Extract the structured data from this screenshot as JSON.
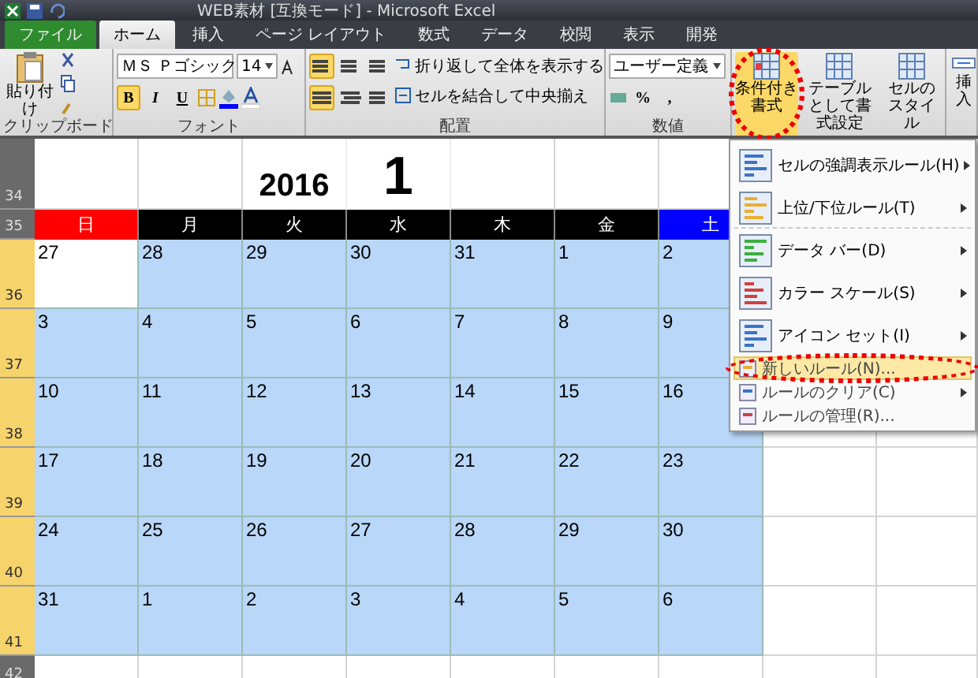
{
  "window": {
    "title": "WEB素材 [互換モード] - Microsoft Excel"
  },
  "tabs": [
    {
      "label": "ファイル",
      "kind": "file",
      "selected": false
    },
    {
      "label": "ホーム",
      "kind": "tab",
      "selected": true
    },
    {
      "label": "挿入",
      "kind": "tab",
      "selected": false
    },
    {
      "label": "ページ レイアウト",
      "kind": "tab",
      "selected": false
    },
    {
      "label": "数式",
      "kind": "tab",
      "selected": false
    },
    {
      "label": "データ",
      "kind": "tab",
      "selected": false
    },
    {
      "label": "校閲",
      "kind": "tab",
      "selected": false
    },
    {
      "label": "表示",
      "kind": "tab",
      "selected": false
    },
    {
      "label": "開発",
      "kind": "tab",
      "selected": false
    }
  ],
  "ribbon": {
    "clipboard": {
      "paste": "貼り付け",
      "label": "クリップボード"
    },
    "font": {
      "name": "ＭＳ Ｐゴシック",
      "size": "14",
      "label": "フォント",
      "styles": [
        {
          "text": "B",
          "selected": true
        },
        {
          "text": "I",
          "selected": false
        },
        {
          "text": "U",
          "selected": false
        }
      ]
    },
    "alignment": {
      "vertical": [
        {
          "selected": true
        },
        {
          "selected": false
        },
        {
          "selected": false
        }
      ],
      "horizontal": [
        {
          "selected": true
        },
        {
          "selected": false
        },
        {
          "selected": false
        }
      ],
      "wrap": "折り返して全体を表示する",
      "merge": "セルを結合して中央揃え",
      "label": "配置"
    },
    "number": {
      "format": "ユーザー定義",
      "percent": "%",
      "comma": ",",
      "label": "数値"
    },
    "styles": [
      {
        "label": "条件付き書式",
        "selected": true,
        "annotated": true
      },
      {
        "label": "テーブルとして書式設定",
        "selected": false,
        "annotated": false
      },
      {
        "label": "セルのスタイル",
        "selected": false,
        "annotated": false
      }
    ],
    "cells": {
      "insert": "挿入"
    }
  },
  "sheet": {
    "row_numbers": [
      {
        "label": "34",
        "selected": false
      },
      {
        "label": "35",
        "selected": false
      },
      {
        "label": "36",
        "selected": true
      },
      {
        "label": "37",
        "selected": true
      },
      {
        "label": "38",
        "selected": true
      },
      {
        "label": "39",
        "selected": true
      },
      {
        "label": "40",
        "selected": true
      },
      {
        "label": "41",
        "selected": true
      },
      {
        "label": "42",
        "selected": false
      }
    ],
    "year": "2016",
    "month": "1",
    "weekdays": [
      {
        "label": "日",
        "color": "#ff0000"
      },
      {
        "label": "月",
        "color": "#000000"
      },
      {
        "label": "火",
        "color": "#000000"
      },
      {
        "label": "水",
        "color": "#000000"
      },
      {
        "label": "木",
        "color": "#000000"
      },
      {
        "label": "金",
        "color": "#000000"
      },
      {
        "label": "土",
        "color": "#0000ff"
      }
    ],
    "weeks": [
      [
        {
          "day": "27",
          "active": true
        },
        {
          "day": "28",
          "active": false
        },
        {
          "day": "29",
          "active": false
        },
        {
          "day": "30",
          "active": false
        },
        {
          "day": "31",
          "active": false
        },
        {
          "day": "1",
          "active": false
        },
        {
          "day": "2",
          "active": false
        }
      ],
      [
        {
          "day": "3",
          "active": false
        },
        {
          "day": "4",
          "active": false
        },
        {
          "day": "5",
          "active": false
        },
        {
          "day": "6",
          "active": false
        },
        {
          "day": "7",
          "active": false
        },
        {
          "day": "8",
          "active": false
        },
        {
          "day": "9",
          "active": false
        }
      ],
      [
        {
          "day": "10",
          "active": false
        },
        {
          "day": "11",
          "active": false
        },
        {
          "day": "12",
          "active": false
        },
        {
          "day": "13",
          "active": false
        },
        {
          "day": "14",
          "active": false
        },
        {
          "day": "15",
          "active": false
        },
        {
          "day": "16",
          "active": false
        }
      ],
      [
        {
          "day": "17",
          "active": false
        },
        {
          "day": "18",
          "active": false
        },
        {
          "day": "19",
          "active": false
        },
        {
          "day": "20",
          "active": false
        },
        {
          "day": "21",
          "active": false
        },
        {
          "day": "22",
          "active": false
        },
        {
          "day": "23",
          "active": false
        }
      ],
      [
        {
          "day": "24",
          "active": false
        },
        {
          "day": "25",
          "active": false
        },
        {
          "day": "26",
          "active": false
        },
        {
          "day": "27",
          "active": false
        },
        {
          "day": "28",
          "active": false
        },
        {
          "day": "29",
          "active": false
        },
        {
          "day": "30",
          "active": false
        }
      ],
      [
        {
          "day": "31",
          "active": false
        },
        {
          "day": "1",
          "active": false
        },
        {
          "day": "2",
          "active": false
        },
        {
          "day": "3",
          "active": false
        },
        {
          "day": "4",
          "active": false
        },
        {
          "day": "5",
          "active": false
        },
        {
          "day": "6",
          "active": false
        }
      ]
    ]
  },
  "menu": [
    {
      "label": "セルの強調表示ルール(H)",
      "kind": "large",
      "submenu": true,
      "selected": false,
      "annotated": false
    },
    {
      "label": "上位/下位ルール(T)",
      "kind": "large",
      "submenu": true,
      "selected": false,
      "annotated": false
    },
    {
      "label": "データ バー(D)",
      "kind": "large",
      "submenu": true,
      "selected": false,
      "annotated": false
    },
    {
      "label": "カラー スケール(S)",
      "kind": "large",
      "submenu": true,
      "selected": false,
      "annotated": false
    },
    {
      "label": "アイコン セット(I)",
      "kind": "large",
      "submenu": true,
      "selected": false,
      "annotated": false
    },
    {
      "label": "新しいルール(N)...",
      "kind": "small",
      "submenu": false,
      "selected": true,
      "annotated": true
    },
    {
      "label": "ルールのクリア(C)",
      "kind": "small",
      "submenu": true,
      "selected": false,
      "annotated": false
    },
    {
      "label": "ルールの管理(R)...",
      "kind": "small",
      "submenu": false,
      "selected": false,
      "annotated": false
    }
  ]
}
